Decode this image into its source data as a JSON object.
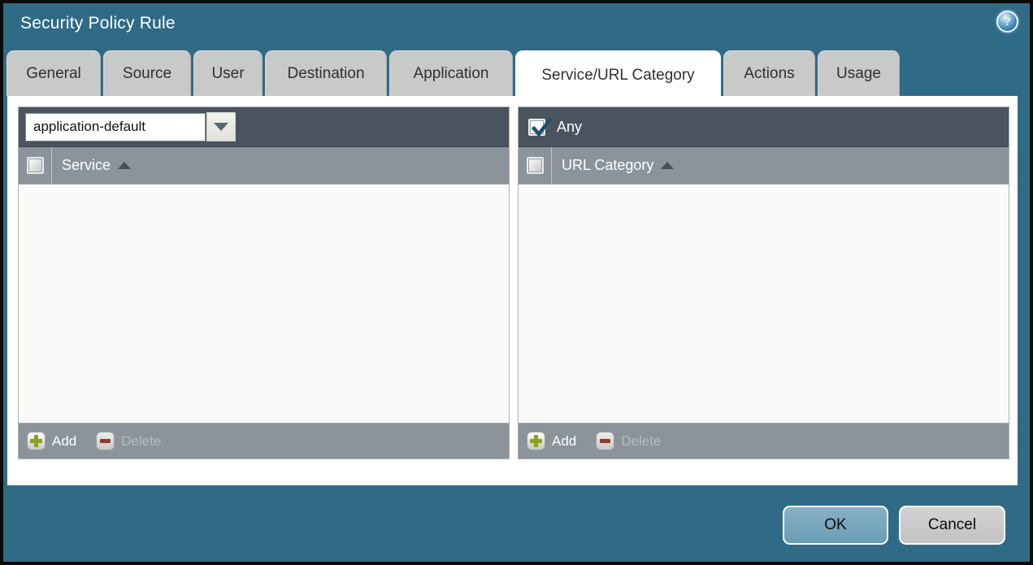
{
  "window": {
    "title": "Security Policy Rule"
  },
  "icons": {
    "help": "?",
    "dropdown_arrow": "triangle-down",
    "sort_asc": "triangle-up",
    "add_plus": "+",
    "delete_minus": "−",
    "checkmark": "✔"
  },
  "tabs": [
    {
      "label": "General",
      "active": false
    },
    {
      "label": "Source",
      "active": false
    },
    {
      "label": "User",
      "active": false
    },
    {
      "label": "Destination",
      "active": false
    },
    {
      "label": "Application",
      "active": false
    },
    {
      "label": "Service/URL Category",
      "active": true
    },
    {
      "label": "Actions",
      "active": false
    },
    {
      "label": "Usage",
      "active": false
    }
  ],
  "service_panel": {
    "service_dropdown": {
      "value": "application-default",
      "expanded": false
    },
    "header": {
      "column": "Service",
      "sort": "asc",
      "checkbox_checked": false
    },
    "rows": [],
    "footer": {
      "add_label": "Add",
      "delete_label": "Delete",
      "delete_enabled": false
    }
  },
  "url_category_panel": {
    "any_checkbox": {
      "label": "Any",
      "checked": true
    },
    "header": {
      "column": "URL Category",
      "sort": "asc",
      "checkbox_checked": false
    },
    "rows": [],
    "footer": {
      "add_label": "Add",
      "delete_label": "Delete",
      "delete_enabled": false
    }
  },
  "dialog_buttons": {
    "ok_label": "OK",
    "cancel_label": "Cancel"
  },
  "colors": {
    "titlebar_teal": "#2f6b86",
    "toolbar_dark": "#4a545f",
    "table_header_gray": "#8b939b",
    "tab_inactive_gray": "#c9c9c9",
    "active_tab_white": "#ffffff",
    "ok_button_blue": "#73a4bc",
    "cancel_button_gray": "#c9c9c9",
    "add_plus_green": "#8ca21c",
    "delete_minus_red": "#8e3a2d",
    "check_blue": "#1d4f6e"
  }
}
